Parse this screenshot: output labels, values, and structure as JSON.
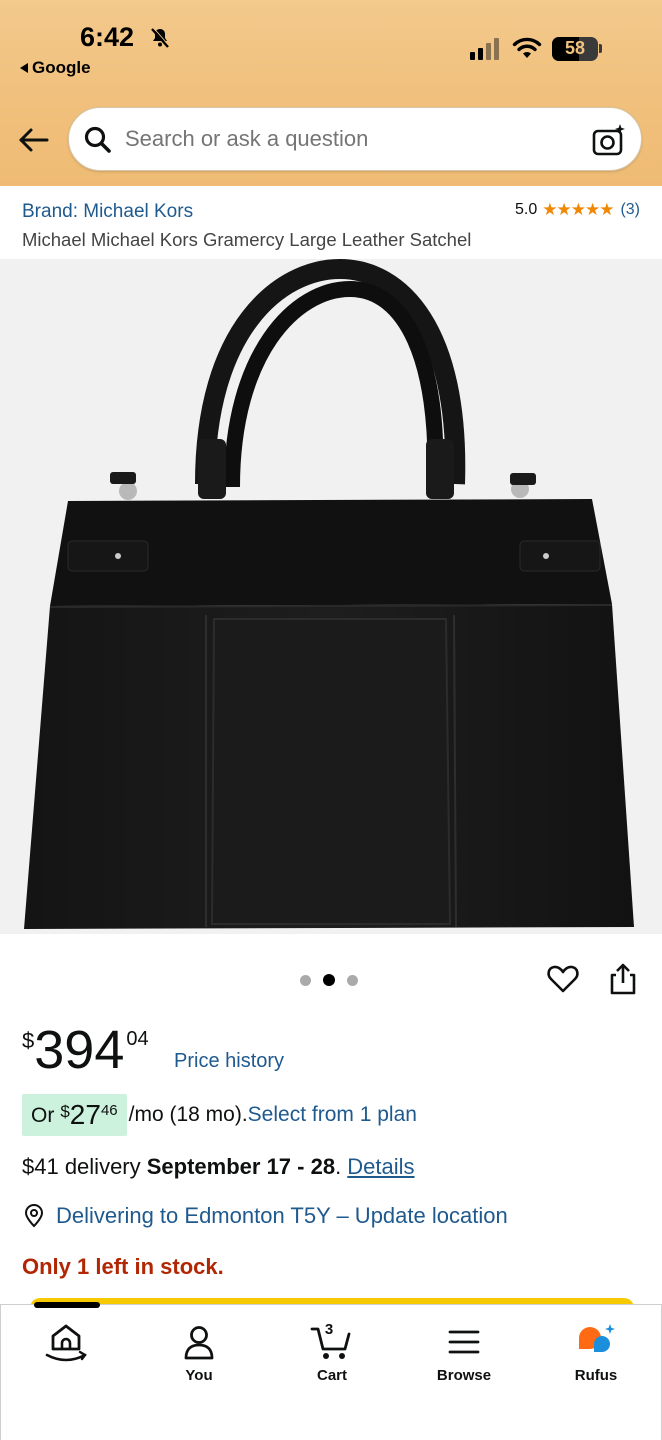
{
  "status_bar": {
    "time": "6:42",
    "back_app": "Google",
    "battery": "58",
    "battery_level": 0.58
  },
  "search": {
    "placeholder": "Search or ask a question"
  },
  "product": {
    "brand": "Brand: Michael Kors",
    "rating_value": "5.0",
    "stars": "★★★★★",
    "rating_count": "(3)",
    "title": "Michael Michael Kors Gramercy Large Leather Satchel",
    "image_count": 3,
    "active_image_index": 1
  },
  "price": {
    "currency_symbol": "$",
    "whole": "394",
    "fraction": "04",
    "history_link": "Price history"
  },
  "installment": {
    "prefix": "Or",
    "currency_symbol": "$",
    "whole": "27",
    "fraction": "46",
    "term": "/mo (18 mo).",
    "link": "Select from 1 plan"
  },
  "delivery": {
    "fee": "$41 delivery ",
    "dates": "September 17 - 28",
    "suffix": ". ",
    "details_link": "Details"
  },
  "location": {
    "text": "Delivering to Edmonton T5Y – Update location"
  },
  "stock": {
    "text": "Only 1 left in stock."
  },
  "bottom_nav": {
    "items": [
      {
        "label": "",
        "icon": "home-icon"
      },
      {
        "label": "You",
        "icon": "user-icon"
      },
      {
        "label": "Cart",
        "icon": "cart-icon",
        "count": "3"
      },
      {
        "label": "Browse",
        "icon": "menu-icon"
      },
      {
        "label": "Rufus",
        "icon": "rufus-icon"
      }
    ]
  },
  "colors": {
    "header_bg": "#f0c07c",
    "link": "#1f5a8f",
    "star": "#f08804",
    "stock_red": "#b12704",
    "installment_highlight": "#ccf2de",
    "cta_yellow": "#f7ca00"
  }
}
